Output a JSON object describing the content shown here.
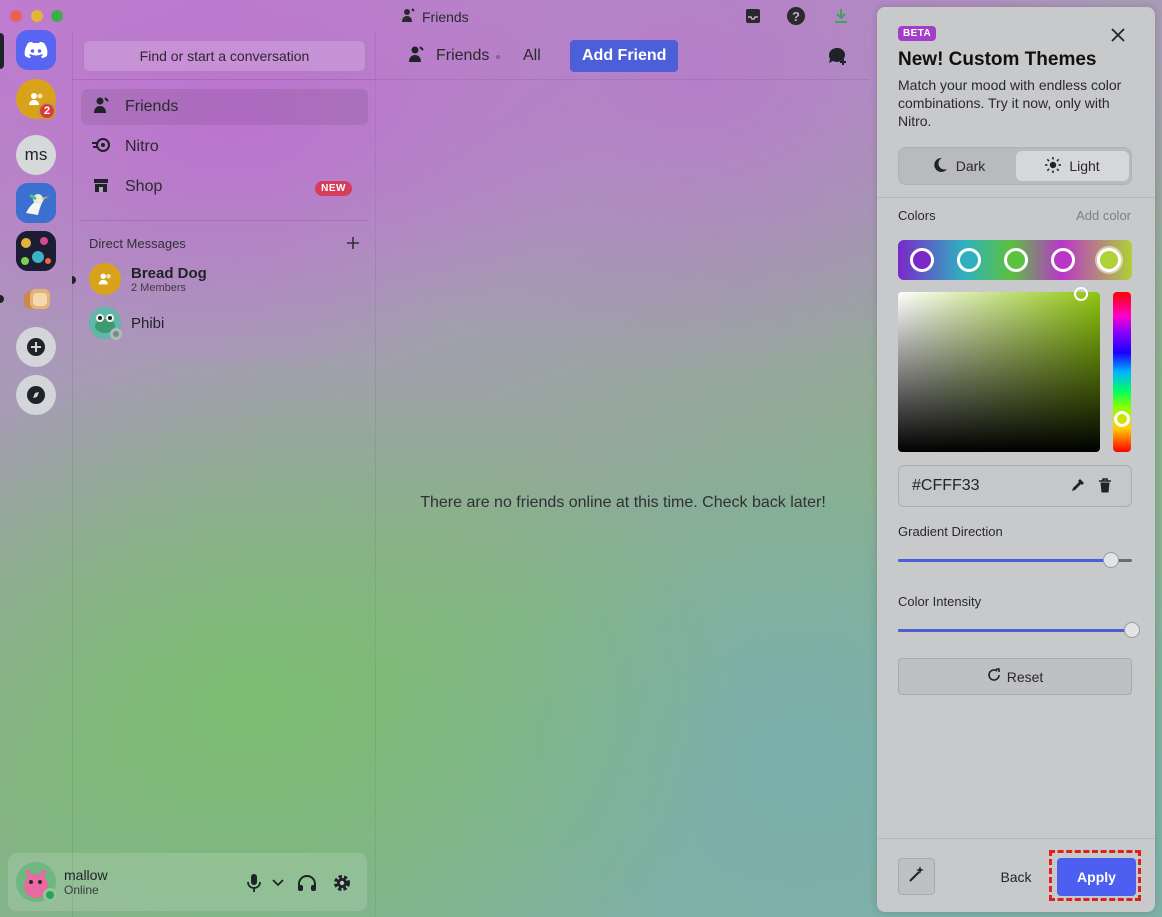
{
  "window": {
    "title": "Friends"
  },
  "rail": {
    "home_label": "Direct Messages",
    "badge_count": "2",
    "server_ms": "ms"
  },
  "sidebar": {
    "search_label": "Find or start a conversation",
    "nav": [
      {
        "label": "Friends",
        "icon": "friends-icon"
      },
      {
        "label": "Nitro",
        "icon": "nitro-icon"
      },
      {
        "label": "Shop",
        "icon": "shop-icon",
        "badge": "NEW"
      }
    ],
    "dm_header": "Direct Messages",
    "dms": [
      {
        "name": "Bread Dog",
        "sub": "2 Members"
      },
      {
        "name": "Phibi"
      }
    ]
  },
  "user": {
    "name": "mallow",
    "status": "Online"
  },
  "header": {
    "title": "Friends",
    "tabs": [
      "All"
    ],
    "add_friend": "Add Friend"
  },
  "main": {
    "empty_message": "There are no friends online at this time. Check back later!"
  },
  "theme_panel": {
    "badge": "BETA",
    "title": "New! Custom Themes",
    "description": "Match your mood with endless color combinations. Try it now, only with Nitro.",
    "mode_dark": "Dark",
    "mode_light": "Light",
    "selected_mode": "Light",
    "colors_label": "Colors",
    "add_color": "Add color",
    "swatches": [
      "#7a28c8",
      "#2fb0c0",
      "#5bc140",
      "#b936c8",
      "#b0d038"
    ],
    "hex_value": "#CFFF33",
    "gradient_label": "Gradient Direction",
    "gradient_value": 0.91,
    "intensity_label": "Color Intensity",
    "intensity_value": 1.0,
    "reset": "Reset",
    "back": "Back",
    "apply": "Apply"
  },
  "colors": {
    "accent": "#4d5ed9",
    "apply": "#4d5ff0",
    "online": "#23a55a",
    "danger": "#d83c3e"
  }
}
